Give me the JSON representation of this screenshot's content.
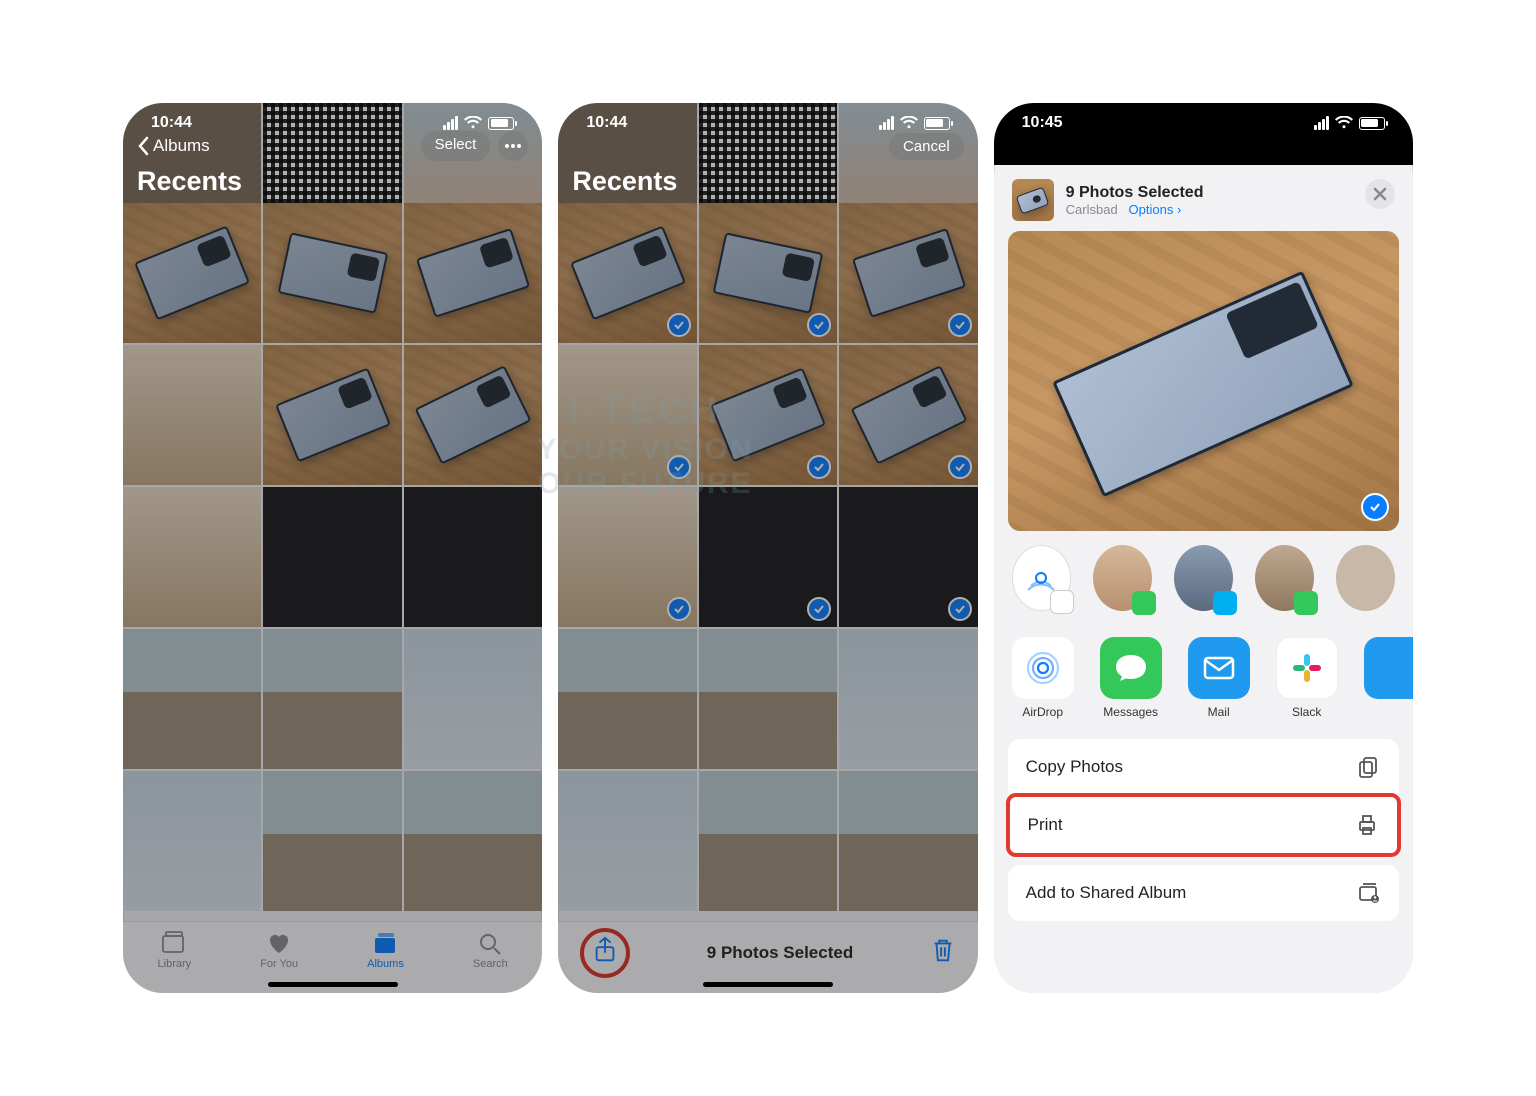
{
  "screen1": {
    "time": "10:44",
    "back": "Albums",
    "select": "Select",
    "title": "Recents",
    "tabs": {
      "library": "Library",
      "foryou": "For You",
      "albums": "Albums",
      "search": "Search"
    }
  },
  "screen2": {
    "time": "10:44",
    "cancel": "Cancel",
    "title": "Recents",
    "selected": "9 Photos Selected"
  },
  "screen3": {
    "time": "10:45",
    "head_title": "9 Photos Selected",
    "head_location": "Carlsbad",
    "head_options": "Options",
    "apps": {
      "airdrop": "AirDrop",
      "messages": "Messages",
      "mail": "Mail",
      "slack": "Slack"
    },
    "actions": {
      "copy": "Copy Photos",
      "print": "Print",
      "shared": "Add to Shared Album"
    }
  },
  "watermark": {
    "l1": "I-TECH",
    "l2a": "YOUR VISION",
    "l2b": "OUR FUTURE"
  }
}
